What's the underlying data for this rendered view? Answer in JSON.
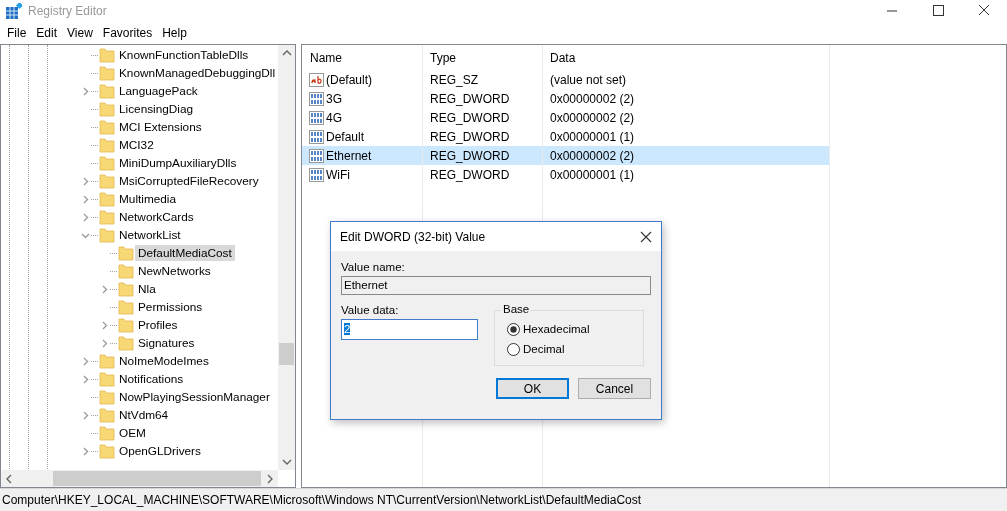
{
  "window": {
    "title": "Registry Editor"
  },
  "menu": [
    "File",
    "Edit",
    "View",
    "Favorites",
    "Help"
  ],
  "tree": {
    "items": [
      {
        "label": "KnownFunctionTableDlls",
        "kind": "leaf",
        "selected": false
      },
      {
        "label": "KnownManagedDebuggingDll",
        "kind": "leaf",
        "selected": false
      },
      {
        "label": "LanguagePack",
        "kind": "branch",
        "expanded": false,
        "selected": false
      },
      {
        "label": "LicensingDiag",
        "kind": "leaf",
        "selected": false
      },
      {
        "label": "MCI Extensions",
        "kind": "leaf",
        "selected": false
      },
      {
        "label": "MCI32",
        "kind": "leaf",
        "selected": false
      },
      {
        "label": "MiniDumpAuxiliaryDlls",
        "kind": "leaf",
        "selected": false
      },
      {
        "label": "MsiCorruptedFileRecovery",
        "kind": "branch",
        "expanded": false,
        "selected": false
      },
      {
        "label": "Multimedia",
        "kind": "branch",
        "expanded": false,
        "selected": false
      },
      {
        "label": "NetworkCards",
        "kind": "branch",
        "expanded": false,
        "selected": false
      },
      {
        "label": "NetworkList",
        "kind": "branch",
        "expanded": true,
        "selected": false,
        "children": [
          {
            "label": "DefaultMediaCost",
            "kind": "leaf",
            "selected": true
          },
          {
            "label": "NewNetworks",
            "kind": "leaf",
            "selected": false
          },
          {
            "label": "Nla",
            "kind": "branch",
            "expanded": false,
            "selected": false
          },
          {
            "label": "Permissions",
            "kind": "leaf",
            "selected": false
          },
          {
            "label": "Profiles",
            "kind": "branch",
            "expanded": false,
            "selected": false
          },
          {
            "label": "Signatures",
            "kind": "branch",
            "expanded": false,
            "selected": false
          }
        ]
      },
      {
        "label": "NoImeModeImes",
        "kind": "branch",
        "expanded": false,
        "selected": false
      },
      {
        "label": "Notifications",
        "kind": "branch",
        "expanded": false,
        "selected": false
      },
      {
        "label": "NowPlayingSessionManager",
        "kind": "leaf",
        "selected": false
      },
      {
        "label": "NtVdm64",
        "kind": "branch",
        "expanded": false,
        "selected": false
      },
      {
        "label": "OEM",
        "kind": "leaf",
        "selected": false
      },
      {
        "label": "OpenGLDrivers",
        "kind": "branch",
        "expanded": false,
        "selected": false
      }
    ]
  },
  "table": {
    "columns": [
      "Name",
      "Type",
      "Data"
    ],
    "rows": [
      {
        "kind": "string",
        "name": "(Default)",
        "type": "REG_SZ",
        "data": "(value not set)",
        "selected": false
      },
      {
        "kind": "binary",
        "name": "3G",
        "type": "REG_DWORD",
        "data": "0x00000002 (2)",
        "selected": false
      },
      {
        "kind": "binary",
        "name": "4G",
        "type": "REG_DWORD",
        "data": "0x00000002 (2)",
        "selected": false
      },
      {
        "kind": "binary",
        "name": "Default",
        "type": "REG_DWORD",
        "data": "0x00000001 (1)",
        "selected": false
      },
      {
        "kind": "binary",
        "name": "Ethernet",
        "type": "REG_DWORD",
        "data": "0x00000002 (2)",
        "selected": true
      },
      {
        "kind": "binary",
        "name": "WiFi",
        "type": "REG_DWORD",
        "data": "0x00000001 (1)",
        "selected": false
      }
    ]
  },
  "dialog": {
    "title": "Edit DWORD (32-bit) Value",
    "value_name_label": "Value name:",
    "value_name": "Ethernet",
    "value_data_label": "Value data:",
    "value_data": "2",
    "base_label": "Base",
    "base_options": [
      {
        "label": "Hexadecimal",
        "selected": true
      },
      {
        "label": "Decimal",
        "selected": false
      }
    ],
    "buttons": [
      "OK",
      "Cancel"
    ]
  },
  "status_bar": "Computer\\HKEY_LOCAL_MACHINE\\SOFTWARE\\Microsoft\\Windows NT\\CurrentVersion\\NetworkList\\DefaultMediaCost"
}
